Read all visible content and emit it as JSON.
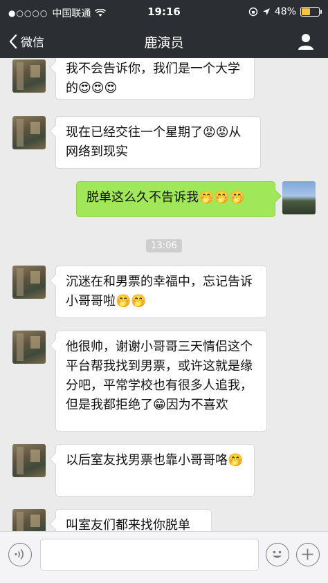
{
  "status_bar": {
    "signal": "●○○○○",
    "carrier": "中国联通",
    "time": "19:16",
    "battery": "48%",
    "battery_level": 0.48
  },
  "nav": {
    "back_label": "微信",
    "title": "鹿演员"
  },
  "messages": [
    {
      "side": "in",
      "text": "我不会告诉你，我们是一个大学的😍😍😍"
    },
    {
      "side": "in",
      "text": "现在已经交往一个星期了😡😡从网络到现实"
    },
    {
      "side": "out",
      "text": "脱单这么久不告诉我🤭🤭🤭"
    },
    {
      "time": "13:06"
    },
    {
      "side": "in",
      "text": "沉迷在和男票的幸福中，忘记告诉小哥哥啦🤭🤭"
    },
    {
      "side": "in",
      "text": "他很帅，谢谢小哥哥三天情侣这个平台帮我找到男票，或许这就是缘分吧，平常学校也有很多人追我，但是我都拒绝了😁因为不喜欢"
    },
    {
      "side": "in",
      "text": "以后室友找男票也靠小哥哥咯🤭"
    },
    {
      "side": "in",
      "text": "叫室友们都来找你脱单"
    }
  ],
  "colors": {
    "header_bg": "#2b2f33",
    "chat_bg": "#ebebeb",
    "out_bubble": "#a0e759",
    "in_bubble": "#ffffff"
  },
  "icons": {
    "back": "chevron-left-icon",
    "contact": "person-icon",
    "voice": "voice-icon",
    "emoji": "emoji-icon",
    "plus": "plus-icon"
  }
}
